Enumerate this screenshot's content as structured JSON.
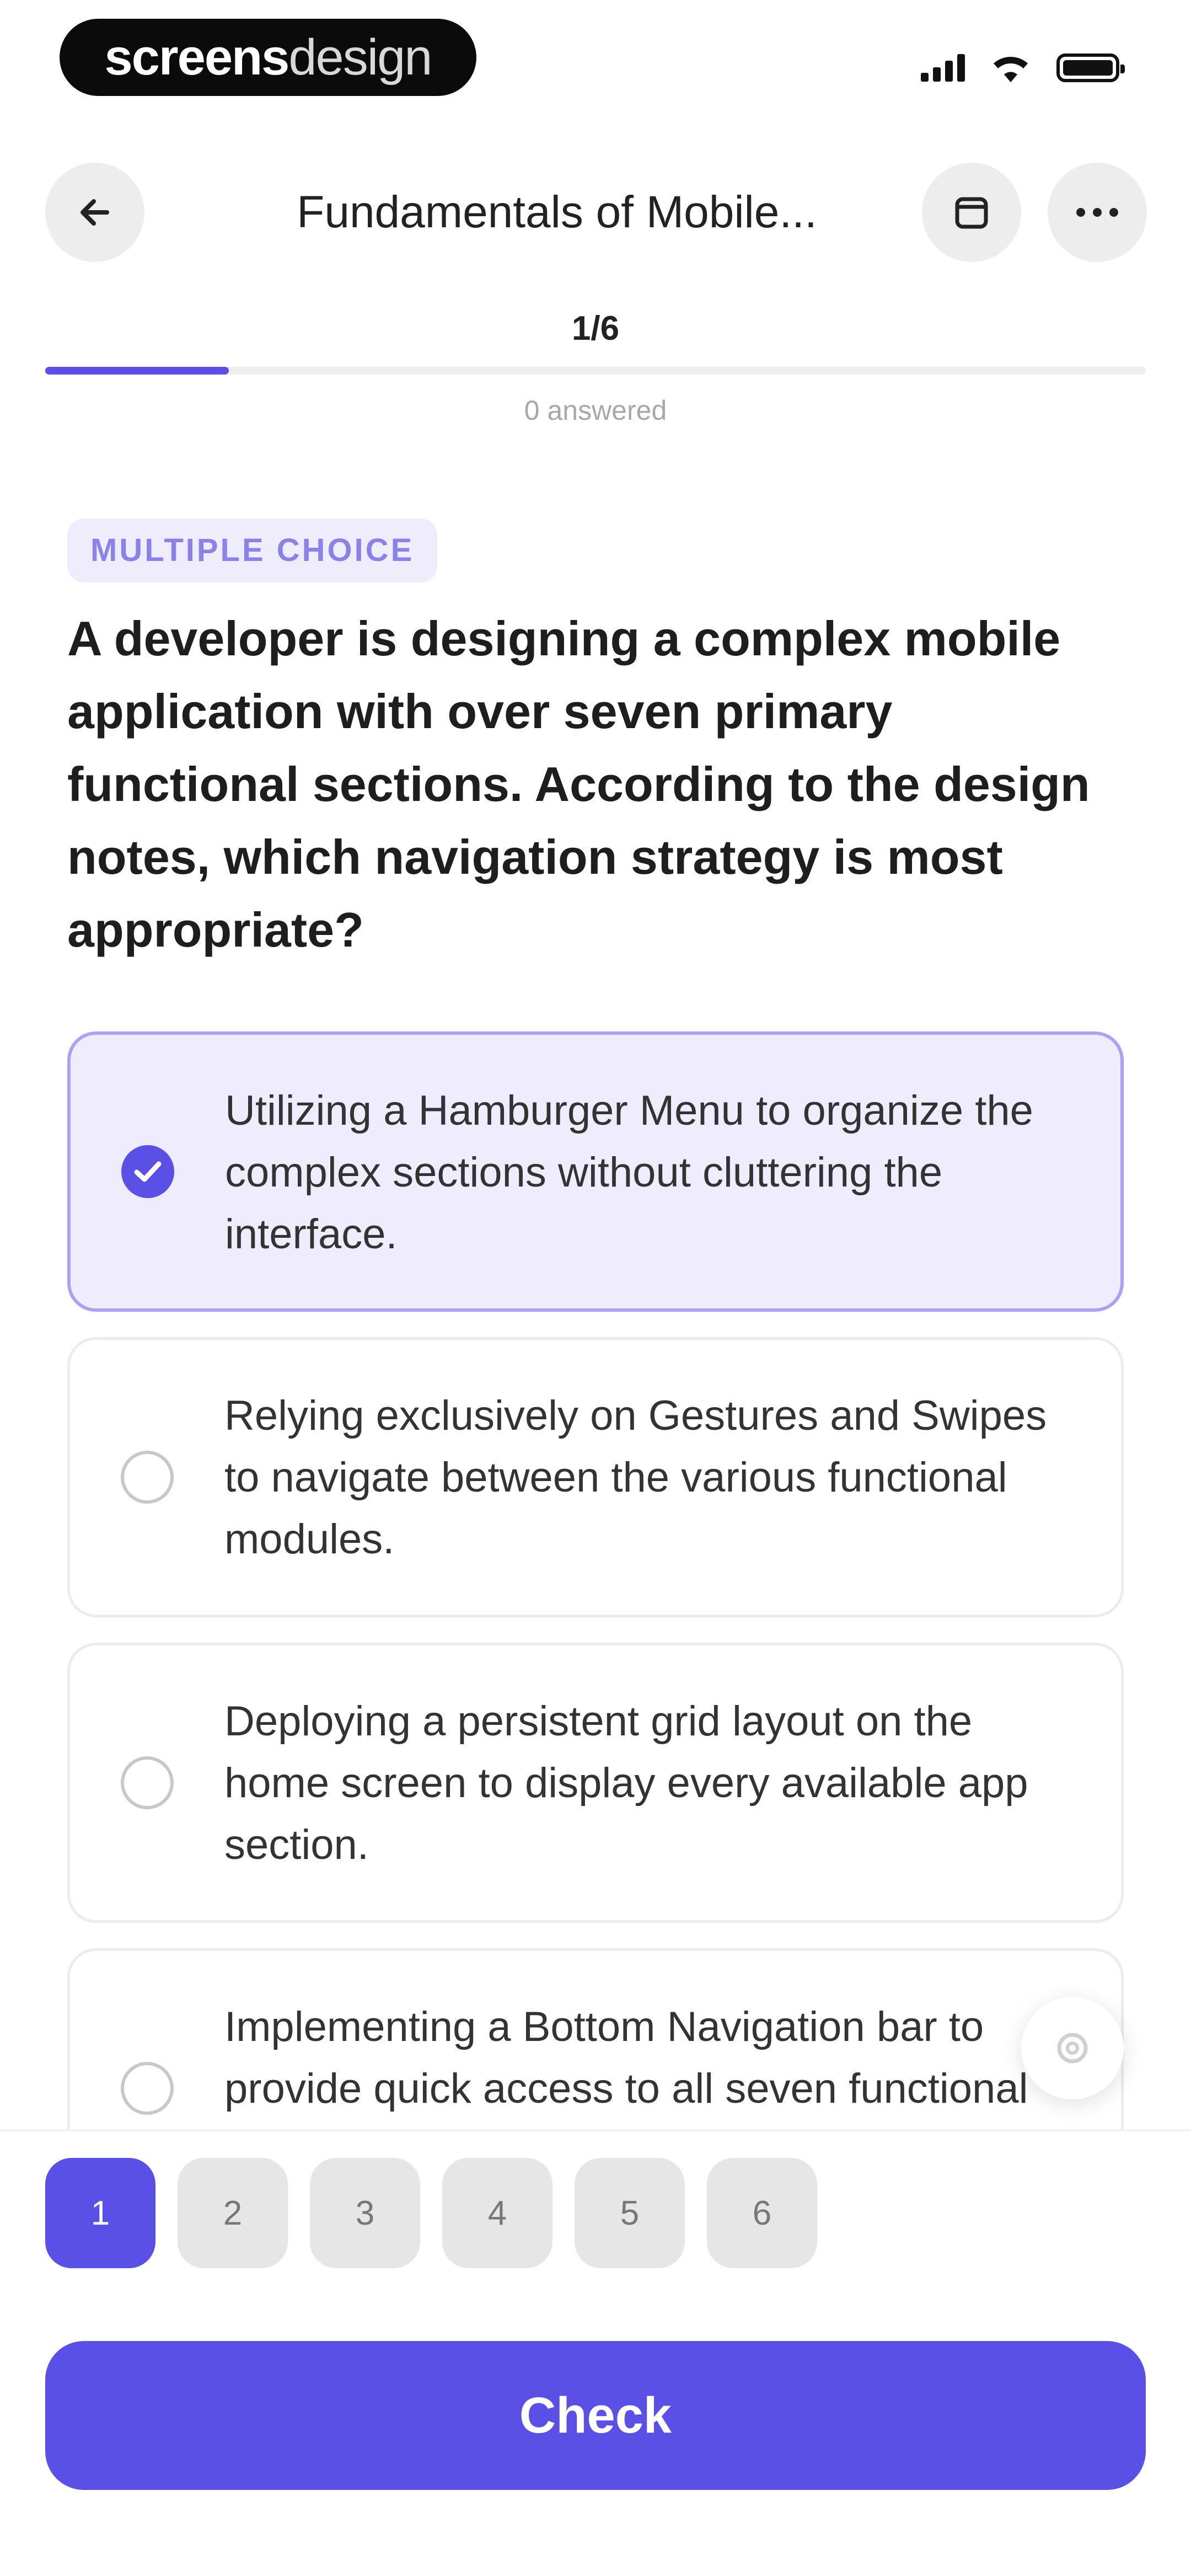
{
  "status_bar": {
    "brand_bold": "screens",
    "brand_light": "design"
  },
  "header": {
    "title": "Fundamentals of Mobile...",
    "back_icon": "arrow-left-icon",
    "bookmark_icon": "bookmark-icon",
    "more_icon": "more-horizontal-icon"
  },
  "progress": {
    "label": "1/6",
    "answered": "0 answered",
    "fraction": 0.1667
  },
  "question": {
    "type_badge": "MULTIPLE CHOICE",
    "text": "A developer is designing a complex mobile application with over seven primary functional sections. According to the design notes, which navigation strategy is most appropriate?"
  },
  "options": [
    {
      "text": "Utilizing a Hamburger Menu to organize the complex sections without cluttering the interface.",
      "selected": true
    },
    {
      "text": "Relying exclusively on Gestures and Swipes to navigate between the various functional modules.",
      "selected": false
    },
    {
      "text": "Deploying a persistent grid layout on the home screen to display every available app section.",
      "selected": false
    },
    {
      "text": "Implementing a Bottom Navigation bar to provide quick access to all seven functional sections.",
      "selected": false
    }
  ],
  "pages": [
    {
      "label": "1",
      "active": true
    },
    {
      "label": "2",
      "active": false
    },
    {
      "label": "3",
      "active": false
    },
    {
      "label": "4",
      "active": false
    },
    {
      "label": "5",
      "active": false
    },
    {
      "label": "6",
      "active": false
    }
  ],
  "check_label": "Check",
  "colors": {
    "accent": "#5B50E6",
    "selected_bg": "#EEECFD",
    "badge_text": "#8A82E8"
  }
}
